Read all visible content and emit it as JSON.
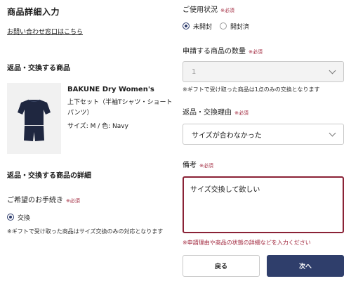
{
  "header": {
    "title": "商品詳細入力",
    "contact_link": "お問い合わせ窓口はこちら"
  },
  "required_label": "※必須",
  "left": {
    "product_section_title": "返品・交換する商品",
    "product": {
      "name": "BAKUNE Dry Women's",
      "description": "上下セット（半袖Tシャツ・ショートパンツ）",
      "spec": "サイズ: M / 色: Navy"
    },
    "detail_section_title": "返品・交換する商品の詳細",
    "procedure_label": "ご希望のお手続き",
    "procedure_option": "交換",
    "procedure_note": "※ギフトで受け取った商品はサイズ交換のみの対応となります"
  },
  "right": {
    "usage_label": "ご使用状況",
    "usage_options": [
      "未開封",
      "開封済"
    ],
    "usage_selected": "未開封",
    "quantity_label": "申請する商品の数量",
    "quantity_value": "1",
    "quantity_note": "※ギフトで受け取った商品は1点のみの交換となります",
    "reason_label": "返品・交換理由",
    "reason_value": "サイズが合わなかった",
    "remarks_label": "備考",
    "remarks_value": "サイズ交換して欲しい",
    "remarks_note": "※申請理由や商品の状態の詳細などを入力ください"
  },
  "buttons": {
    "back": "戻る",
    "next": "次へ"
  },
  "colors": {
    "accent": "#2f3e6b",
    "required": "#a0263c",
    "product_navy": "#1f2740"
  }
}
